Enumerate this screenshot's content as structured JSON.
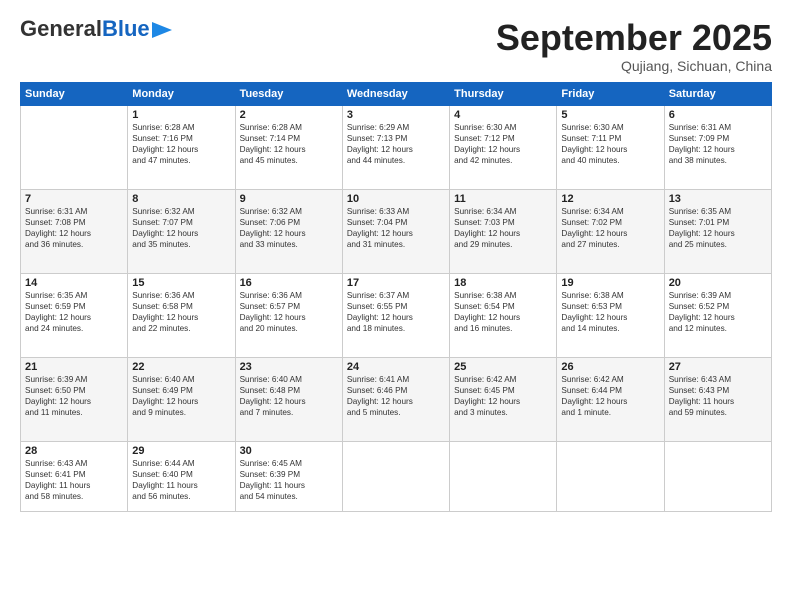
{
  "header": {
    "logo_line1": "General",
    "logo_line2": "Blue",
    "month": "September 2025",
    "location": "Qujiang, Sichuan, China"
  },
  "days_of_week": [
    "Sunday",
    "Monday",
    "Tuesday",
    "Wednesday",
    "Thursday",
    "Friday",
    "Saturday"
  ],
  "weeks": [
    [
      {
        "day": "",
        "info": ""
      },
      {
        "day": "1",
        "info": "Sunrise: 6:28 AM\nSunset: 7:16 PM\nDaylight: 12 hours\nand 47 minutes."
      },
      {
        "day": "2",
        "info": "Sunrise: 6:28 AM\nSunset: 7:14 PM\nDaylight: 12 hours\nand 45 minutes."
      },
      {
        "day": "3",
        "info": "Sunrise: 6:29 AM\nSunset: 7:13 PM\nDaylight: 12 hours\nand 44 minutes."
      },
      {
        "day": "4",
        "info": "Sunrise: 6:30 AM\nSunset: 7:12 PM\nDaylight: 12 hours\nand 42 minutes."
      },
      {
        "day": "5",
        "info": "Sunrise: 6:30 AM\nSunset: 7:11 PM\nDaylight: 12 hours\nand 40 minutes."
      },
      {
        "day": "6",
        "info": "Sunrise: 6:31 AM\nSunset: 7:09 PM\nDaylight: 12 hours\nand 38 minutes."
      }
    ],
    [
      {
        "day": "7",
        "info": "Sunrise: 6:31 AM\nSunset: 7:08 PM\nDaylight: 12 hours\nand 36 minutes."
      },
      {
        "day": "8",
        "info": "Sunrise: 6:32 AM\nSunset: 7:07 PM\nDaylight: 12 hours\nand 35 minutes."
      },
      {
        "day": "9",
        "info": "Sunrise: 6:32 AM\nSunset: 7:06 PM\nDaylight: 12 hours\nand 33 minutes."
      },
      {
        "day": "10",
        "info": "Sunrise: 6:33 AM\nSunset: 7:04 PM\nDaylight: 12 hours\nand 31 minutes."
      },
      {
        "day": "11",
        "info": "Sunrise: 6:34 AM\nSunset: 7:03 PM\nDaylight: 12 hours\nand 29 minutes."
      },
      {
        "day": "12",
        "info": "Sunrise: 6:34 AM\nSunset: 7:02 PM\nDaylight: 12 hours\nand 27 minutes."
      },
      {
        "day": "13",
        "info": "Sunrise: 6:35 AM\nSunset: 7:01 PM\nDaylight: 12 hours\nand 25 minutes."
      }
    ],
    [
      {
        "day": "14",
        "info": "Sunrise: 6:35 AM\nSunset: 6:59 PM\nDaylight: 12 hours\nand 24 minutes."
      },
      {
        "day": "15",
        "info": "Sunrise: 6:36 AM\nSunset: 6:58 PM\nDaylight: 12 hours\nand 22 minutes."
      },
      {
        "day": "16",
        "info": "Sunrise: 6:36 AM\nSunset: 6:57 PM\nDaylight: 12 hours\nand 20 minutes."
      },
      {
        "day": "17",
        "info": "Sunrise: 6:37 AM\nSunset: 6:55 PM\nDaylight: 12 hours\nand 18 minutes."
      },
      {
        "day": "18",
        "info": "Sunrise: 6:38 AM\nSunset: 6:54 PM\nDaylight: 12 hours\nand 16 minutes."
      },
      {
        "day": "19",
        "info": "Sunrise: 6:38 AM\nSunset: 6:53 PM\nDaylight: 12 hours\nand 14 minutes."
      },
      {
        "day": "20",
        "info": "Sunrise: 6:39 AM\nSunset: 6:52 PM\nDaylight: 12 hours\nand 12 minutes."
      }
    ],
    [
      {
        "day": "21",
        "info": "Sunrise: 6:39 AM\nSunset: 6:50 PM\nDaylight: 12 hours\nand 11 minutes."
      },
      {
        "day": "22",
        "info": "Sunrise: 6:40 AM\nSunset: 6:49 PM\nDaylight: 12 hours\nand 9 minutes."
      },
      {
        "day": "23",
        "info": "Sunrise: 6:40 AM\nSunset: 6:48 PM\nDaylight: 12 hours\nand 7 minutes."
      },
      {
        "day": "24",
        "info": "Sunrise: 6:41 AM\nSunset: 6:46 PM\nDaylight: 12 hours\nand 5 minutes."
      },
      {
        "day": "25",
        "info": "Sunrise: 6:42 AM\nSunset: 6:45 PM\nDaylight: 12 hours\nand 3 minutes."
      },
      {
        "day": "26",
        "info": "Sunrise: 6:42 AM\nSunset: 6:44 PM\nDaylight: 12 hours\nand 1 minute."
      },
      {
        "day": "27",
        "info": "Sunrise: 6:43 AM\nSunset: 6:43 PM\nDaylight: 11 hours\nand 59 minutes."
      }
    ],
    [
      {
        "day": "28",
        "info": "Sunrise: 6:43 AM\nSunset: 6:41 PM\nDaylight: 11 hours\nand 58 minutes."
      },
      {
        "day": "29",
        "info": "Sunrise: 6:44 AM\nSunset: 6:40 PM\nDaylight: 11 hours\nand 56 minutes."
      },
      {
        "day": "30",
        "info": "Sunrise: 6:45 AM\nSunset: 6:39 PM\nDaylight: 11 hours\nand 54 minutes."
      },
      {
        "day": "",
        "info": ""
      },
      {
        "day": "",
        "info": ""
      },
      {
        "day": "",
        "info": ""
      },
      {
        "day": "",
        "info": ""
      }
    ]
  ]
}
